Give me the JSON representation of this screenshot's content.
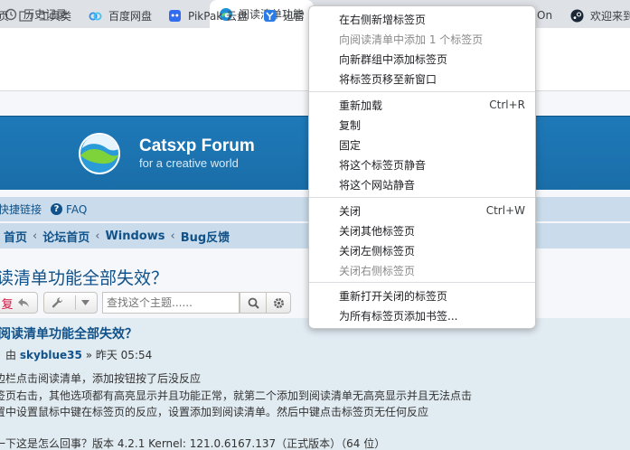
{
  "browser": {
    "tabs": [
      {
        "label": "历史记录",
        "icon": "history-icon"
      },
      {
        "label": "阅读清单功能",
        "icon": "edge-icon"
      }
    ],
    "bookmarks": [
      {
        "label": "页",
        "icon": "page-fragment"
      },
      {
        "label": "工具类",
        "icon": "folder-icon"
      },
      {
        "label": "百度网盘",
        "icon": "baidu-netdisk-icon"
      },
      {
        "label": "PikPak 云盘",
        "icon": "pikpak-icon"
      },
      {
        "label": "迅雷",
        "icon": "xunlei-icon"
      },
      {
        "label": "On",
        "icon": ""
      },
      {
        "label": "欢迎来到",
        "icon": "steam-icon"
      }
    ]
  },
  "forum": {
    "site_title": "Catsxp Forum",
    "site_subtitle": "for a creative world",
    "quicklinks": "快捷链接",
    "faq": "FAQ",
    "breadcrumbs": [
      "首页",
      "论坛首页",
      "Windows",
      "Bug反馈"
    ],
    "topic_title": "读清单功能全部失效？",
    "reply_button": "复",
    "search_placeholder": "查找这个主题......",
    "post": {
      "title": "阅读清单功能全部失效？",
      "by": "由",
      "author": "skyblue35",
      "time": "» 昨天 05:54",
      "lines": [
        "边栏点击阅读清单，添加按钮按了后没反应",
        "签页右击，其他选项都有高亮显示并且功能正常，就第二个添加到阅读清单无高亮显示并且无法点击",
        "置中设置鼠标中键在标签页的反应，设置添加到阅读清单。然后中键点击标签页无任何反应",
        "一下这是怎么回事？版本 4.2.1 Kernel: 121.0.6167.137（正式版本）（64 位）"
      ]
    }
  },
  "context_menu": {
    "groups": [
      [
        {
          "label": "在右侧新增标签页",
          "disabled": false
        },
        {
          "label": "向阅读清单中添加 1 个标签页",
          "disabled": true
        },
        {
          "label": "向新群组中添加标签页",
          "disabled": false
        },
        {
          "label": "将标签页移至新窗口",
          "disabled": false
        }
      ],
      [
        {
          "label": "重新加载",
          "shortcut": "Ctrl+R",
          "disabled": false
        },
        {
          "label": "复制",
          "disabled": false
        },
        {
          "label": "固定",
          "disabled": false
        },
        {
          "label": "将这个标签页静音",
          "disabled": false
        },
        {
          "label": "将这个网站静音",
          "disabled": false
        }
      ],
      [
        {
          "label": "关闭",
          "shortcut": "Ctrl+W",
          "disabled": false
        },
        {
          "label": "关闭其他标签页",
          "disabled": false
        },
        {
          "label": "关闭左侧标签页",
          "disabled": false
        },
        {
          "label": "关闭右侧标签页",
          "disabled": true
        }
      ],
      [
        {
          "label": "重新打开关闭的标签页",
          "disabled": false
        },
        {
          "label": "为所有标签页添加书签...",
          "disabled": false
        }
      ]
    ]
  },
  "colors": {
    "header_blue": "#1e79b8",
    "link_blue": "#105289",
    "nav_bg": "#cadceb",
    "post_bg": "#e1ebf2",
    "reply_red": "#d31141"
  }
}
